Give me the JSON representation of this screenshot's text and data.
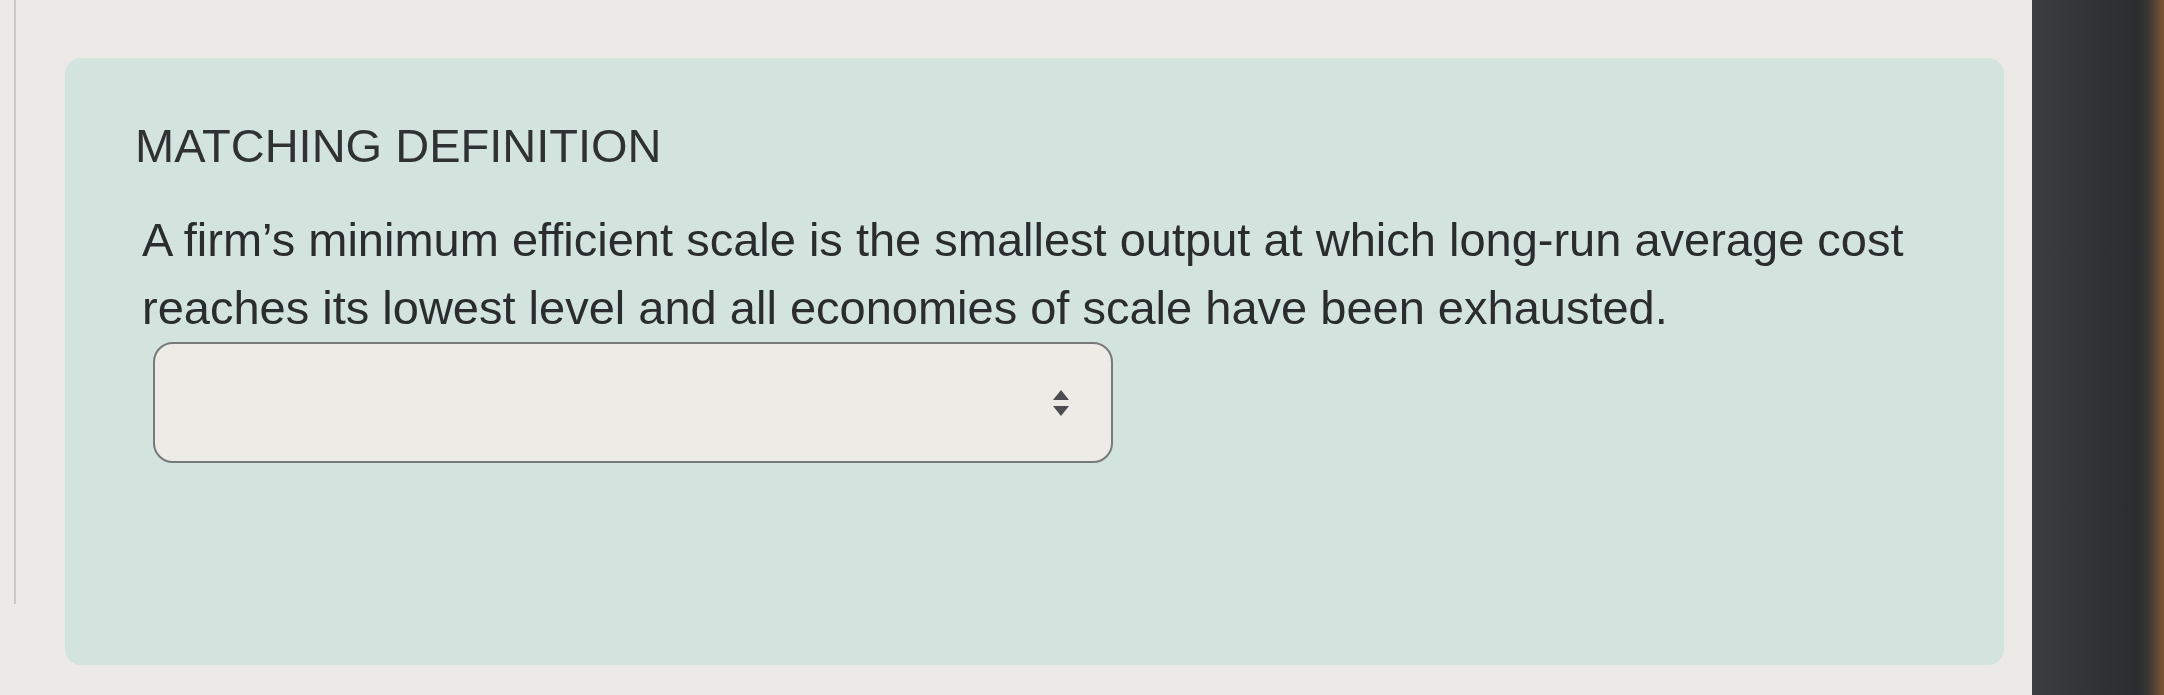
{
  "question": {
    "heading": "MATCHING DEFINITION",
    "definition": "A firm’s minimum efficient scale is the smallest output at which long-run average cost reaches its lowest level and all economies of scale have been exhausted.",
    "answer": {
      "kind": "dropdown"
    }
  }
}
